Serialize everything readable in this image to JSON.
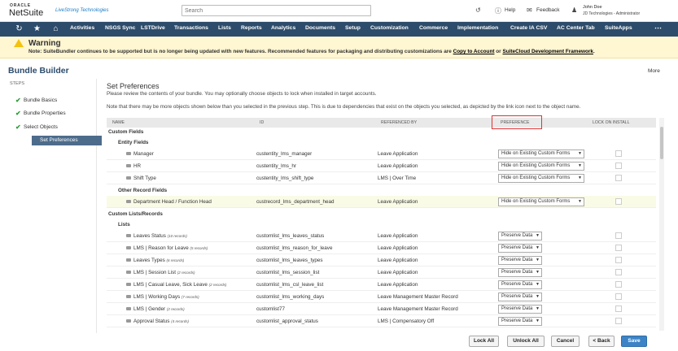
{
  "header": {
    "oracle": "ORACLE",
    "brand": "NetSuite",
    "partner": "LiveStrong Technologies",
    "search_placeholder": "Search",
    "help": "Help",
    "feedback": "Feedback",
    "user_name": "John Doe",
    "user_role": "JD Technologies - Administrator"
  },
  "nav": {
    "items": [
      "Activities",
      "NSGS Sync",
      "LSTDrive",
      "Transactions",
      "Lists",
      "Reports",
      "Analytics",
      "Documents",
      "Setup",
      "Customization",
      "Commerce",
      "Implementation",
      "Create IA CSV",
      "AC Center Tab",
      "SuiteApps"
    ],
    "more": "⋯"
  },
  "warning": {
    "title": "Warning",
    "text_prefix": "Note: SuiteBundler continues to be supported but is no longer being updated with new features. Recommended features for packaging and distributing customizations are ",
    "link1": "Copy to Account",
    "mid": " or ",
    "link2": "SuiteCloud Development Framework",
    "suffix": "."
  },
  "page": {
    "title": "Bundle Builder",
    "more": "More"
  },
  "steps": {
    "label": "STEPS",
    "items": [
      "Bundle Basics",
      "Bundle Properties",
      "Select Objects",
      "Set Preferences"
    ]
  },
  "main": {
    "title": "Set Preferences",
    "desc1": "Please review the contents of your bundle. You may optionally choose objects to lock when installed in target accounts.",
    "desc2": "Note that there may be more objects shown below than you selected in the previous step. This is due to dependencies that exist on the objects you selected, as depicted by the link icon next to the object name."
  },
  "table": {
    "headers": [
      "NAME",
      "ID",
      "REFERENCED BY",
      "PREFERENCE",
      "LOCK ON INSTALL"
    ],
    "sections": {
      "custom_fields": "Custom Fields",
      "entity_fields": "Entity Fields",
      "other_record_fields": "Other Record Fields",
      "custom_lists": "Custom Lists/Records",
      "lists": "Lists"
    },
    "entity_rows": [
      {
        "name": "Manager",
        "id": "custentity_lms_manager",
        "ref": "Leave Application",
        "pref": "Hide on Existing Custom Forms"
      },
      {
        "name": "HR",
        "id": "custentity_lms_hr",
        "ref": "Leave Application",
        "pref": "Hide on Existing Custom Forms"
      },
      {
        "name": "Shift Type",
        "id": "custentity_lms_shift_type",
        "ref": "LMS | Over Time",
        "pref": "Hide on Existing Custom Forms"
      }
    ],
    "other_rows": [
      {
        "name": "Department Head / Function Head",
        "id": "custrecord_lms_department_head",
        "ref": "Leave Application",
        "pref": "Hide on Existing Custom Forms"
      }
    ],
    "list_rows": [
      {
        "name": "Leaves Status",
        "count": "(10 records)",
        "id": "customlist_lms_leaves_status",
        "ref": "Leave Application",
        "pref": "Preserve Data"
      },
      {
        "name": "LMS | Reason for Leave",
        "count": "(5 records)",
        "id": "customlist_lms_reason_for_leave",
        "ref": "Leave Application",
        "pref": "Preserve Data"
      },
      {
        "name": "Leaves Types",
        "count": "(6 records)",
        "id": "customlist_lms_leaves_types",
        "ref": "Leave Application",
        "pref": "Preserve Data"
      },
      {
        "name": "LMS | Session List",
        "count": "(2 records)",
        "id": "customlist_lms_session_list",
        "ref": "Leave Application",
        "pref": "Preserve Data"
      },
      {
        "name": "LMS | Casual Leave, Sick Leave",
        "count": "(2 records)",
        "id": "customlist_lms_csl_leave_list",
        "ref": "Leave Application",
        "pref": "Preserve Data"
      },
      {
        "name": "LMS | Working Days",
        "count": "(7 records)",
        "id": "customlist_lms_working_days",
        "ref": "Leave Management Master Record",
        "pref": "Preserve Data"
      },
      {
        "name": "LMS | Gender",
        "count": "(2 records)",
        "id": "customlist77",
        "ref": "Leave Management Master Record",
        "pref": "Preserve Data"
      },
      {
        "name": "Approval Status",
        "count": "(4 records)",
        "id": "customlist_approval_status",
        "ref": "LMS | Compensatory Off",
        "pref": "Preserve Data"
      }
    ]
  },
  "footer": {
    "lock_all": "Lock All",
    "unlock_all": "Unlock All",
    "cancel": "Cancel",
    "back": "< Back",
    "save": "Save"
  }
}
